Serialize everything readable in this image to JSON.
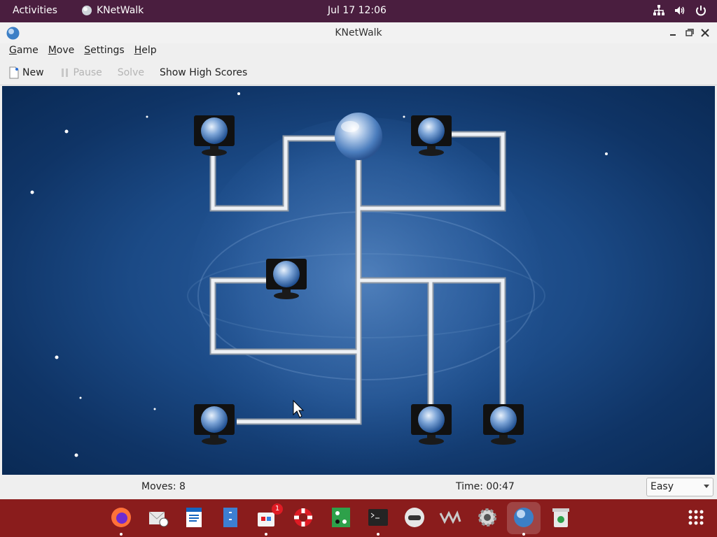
{
  "topbar": {
    "activities": "Activities",
    "app_name": "KNetWalk",
    "clock": "Jul 17  12:06",
    "tray_icons": [
      "network-icon",
      "volume-icon",
      "power-icon"
    ]
  },
  "window": {
    "title": "KNetWalk",
    "controls": [
      "minimize",
      "maximize",
      "close"
    ]
  },
  "menubar": [
    {
      "label": "Game",
      "mnemonic": "G"
    },
    {
      "label": "Move",
      "mnemonic": "M"
    },
    {
      "label": "Settings",
      "mnemonic": "S"
    },
    {
      "label": "Help",
      "mnemonic": "H"
    }
  ],
  "toolbar": {
    "new_label": "New",
    "pause_label": "Pause",
    "solve_label": "Solve",
    "highscores_label": "Show High Scores"
  },
  "status": {
    "moves": "Moves: 8",
    "time": "Time: 00:47",
    "difficulty": "Easy"
  },
  "dock": {
    "apps": [
      "firefox",
      "evolution",
      "writer",
      "files",
      "software",
      "help",
      "sol",
      "terminal",
      "kvm",
      "vm",
      "settings",
      "knetwalk",
      "trash"
    ],
    "software_badge": "1",
    "active_app": "knetwalk"
  },
  "colors": {
    "topbar": "#4a1e3f",
    "dock": "#8a1c1c",
    "board_dark": "#0f3466",
    "cable": "#dfe3e8"
  }
}
